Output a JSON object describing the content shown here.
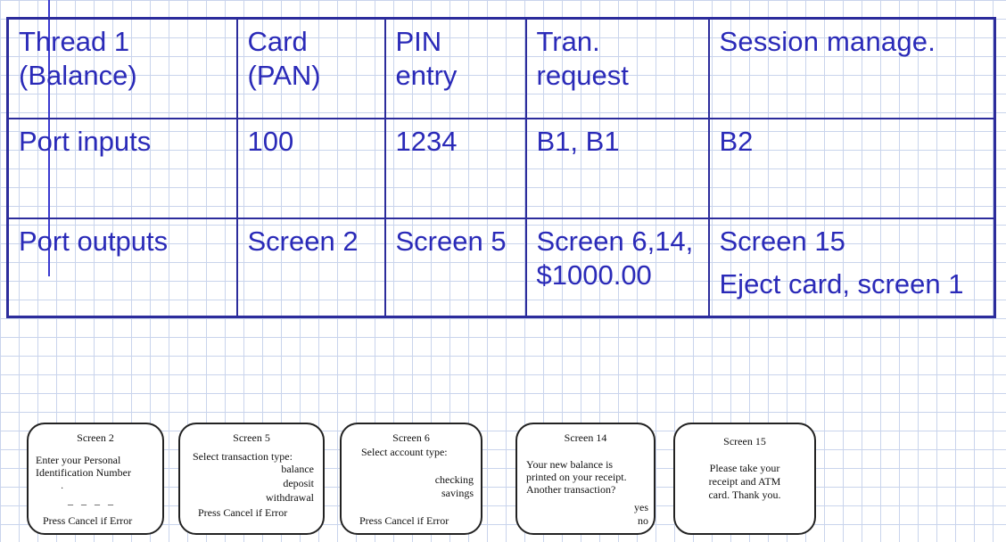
{
  "table": {
    "rows": [
      [
        "Thread 1\n(Balance)",
        "Card\n(PAN)",
        "PIN\nentry",
        "Tran.\nrequest",
        "Session manage."
      ],
      [
        "Port inputs",
        "100",
        "1234",
        "B1, B1",
        "B2"
      ],
      [
        "Port outputs",
        "Screen 2",
        "Screen 5",
        "Screen 6,14,\n$1000.00",
        "Screen 15\nEject card, screen 1"
      ]
    ]
  },
  "screens": {
    "s2": {
      "title": "Screen 2",
      "line1": "Enter your Personal",
      "line2": "Identification Number",
      "dot": "·",
      "dashes": "_ _ _ _",
      "footer": "Press Cancel if Error"
    },
    "s5": {
      "title": "Screen 5",
      "prompt": "Select transaction type:",
      "opt1": "balance",
      "opt2": "deposit",
      "opt3": "withdrawal",
      "footer": "Press Cancel if Error"
    },
    "s6": {
      "title": "Screen 6",
      "prompt": "Select account type:",
      "opt1": "checking",
      "opt2": "savings",
      "footer": "Press Cancel if Error"
    },
    "s14": {
      "title": "Screen 14",
      "line1": "Your new balance is",
      "line2": "printed on your receipt.",
      "line3": "Another transaction?",
      "yes": "yes",
      "no": "no"
    },
    "s15": {
      "title": "Screen 15",
      "line1": "Please take your",
      "line2": "receipt and ATM",
      "line3": "card.  Thank you."
    }
  }
}
